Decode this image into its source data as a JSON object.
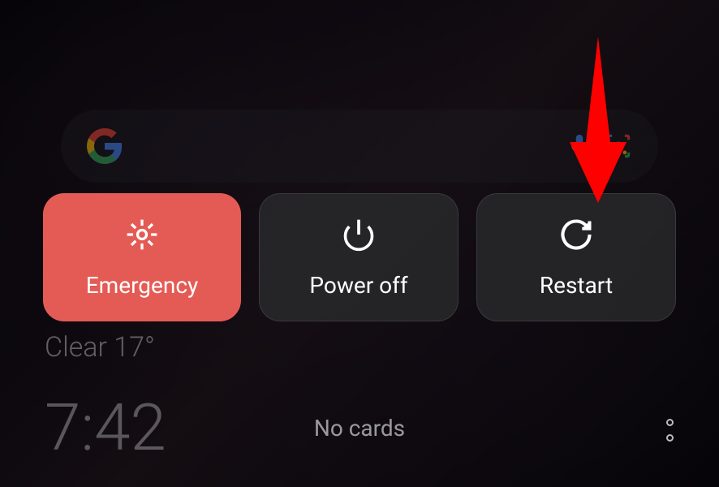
{
  "search": {
    "placeholder": ""
  },
  "power_menu": {
    "emergency": {
      "label": "Emergency"
    },
    "power_off": {
      "label": "Power off"
    },
    "restart": {
      "label": "Restart"
    }
  },
  "weather": {
    "text": "Clear 17°"
  },
  "clock": {
    "time": "7:42"
  },
  "cards": {
    "empty_text": "No cards"
  },
  "annotation": {
    "arrow_color": "#ff0000",
    "target": "restart-button"
  }
}
